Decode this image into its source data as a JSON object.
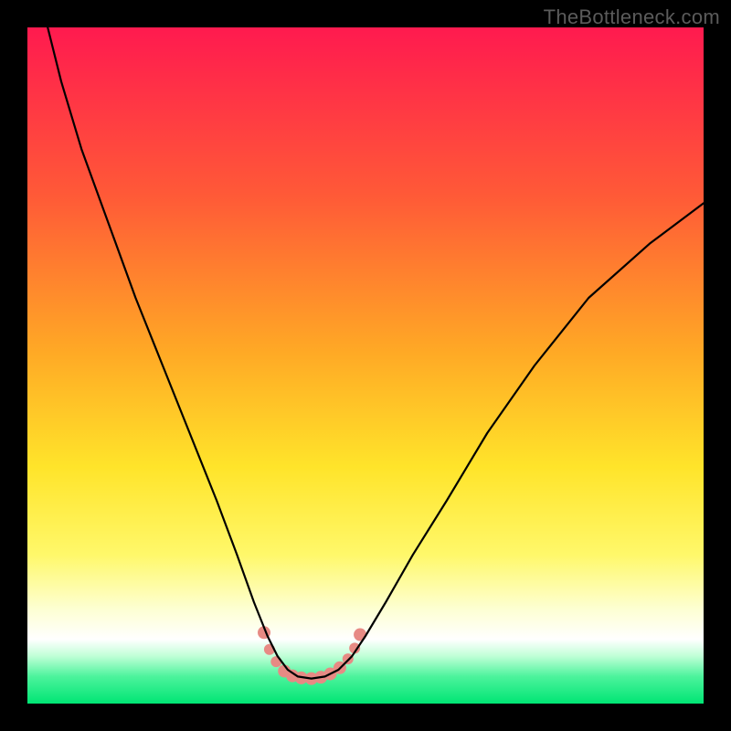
{
  "watermark": "TheBottleneck.com",
  "chart_data": {
    "type": "line",
    "title": "",
    "xlabel": "",
    "ylabel": "",
    "xlim": [
      0,
      100
    ],
    "ylim": [
      0,
      100
    ],
    "grid": false,
    "background_gradient": {
      "direction": "vertical",
      "stops": [
        {
          "offset": 0.0,
          "color": "#ff1a4f"
        },
        {
          "offset": 0.25,
          "color": "#ff5a37"
        },
        {
          "offset": 0.48,
          "color": "#ffa925"
        },
        {
          "offset": 0.65,
          "color": "#ffe42a"
        },
        {
          "offset": 0.78,
          "color": "#fff86a"
        },
        {
          "offset": 0.86,
          "color": "#fdffd2"
        },
        {
          "offset": 0.905,
          "color": "#ffffff"
        },
        {
          "offset": 0.93,
          "color": "#bfffd6"
        },
        {
          "offset": 0.96,
          "color": "#4cf39c"
        },
        {
          "offset": 1.0,
          "color": "#00e574"
        }
      ]
    },
    "series": [
      {
        "name": "bottleneck-curve",
        "color": "#000000",
        "width": 2.2,
        "x": [
          3,
          5,
          8,
          12,
          16,
          20,
          24,
          28,
          31,
          33.5,
          35.5,
          37,
          38.5,
          40,
          42,
          44,
          46,
          48,
          50,
          53,
          57,
          62,
          68,
          75,
          83,
          92,
          100
        ],
        "y": [
          100,
          92,
          82,
          71,
          60,
          50,
          40,
          30,
          22,
          15,
          10,
          7,
          5,
          4,
          3.7,
          4,
          5,
          7,
          10,
          15,
          22,
          30,
          40,
          50,
          60,
          68,
          74
        ]
      }
    ],
    "markers": [
      {
        "name": "sweet-spot-band",
        "color": "#e78a84",
        "points": [
          {
            "x": 35.0,
            "y": 10.5,
            "r": 7
          },
          {
            "x": 35.8,
            "y": 8.0,
            "r": 6
          },
          {
            "x": 36.8,
            "y": 6.2,
            "r": 6
          },
          {
            "x": 38.0,
            "y": 4.8,
            "r": 7
          },
          {
            "x": 39.2,
            "y": 4.1,
            "r": 7
          },
          {
            "x": 40.5,
            "y": 3.8,
            "r": 7
          },
          {
            "x": 42.0,
            "y": 3.7,
            "r": 7
          },
          {
            "x": 43.4,
            "y": 3.9,
            "r": 7
          },
          {
            "x": 44.8,
            "y": 4.4,
            "r": 7
          },
          {
            "x": 46.2,
            "y": 5.3,
            "r": 7
          },
          {
            "x": 47.4,
            "y": 6.6,
            "r": 6
          },
          {
            "x": 48.4,
            "y": 8.2,
            "r": 6
          },
          {
            "x": 49.2,
            "y": 10.2,
            "r": 7
          }
        ]
      }
    ]
  }
}
